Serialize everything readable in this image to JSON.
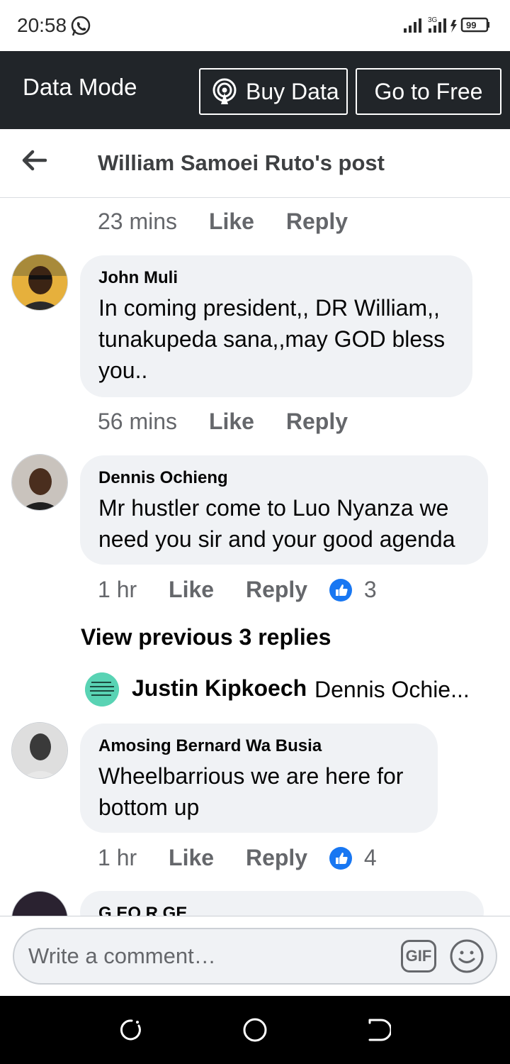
{
  "status_bar": {
    "time": "20:58",
    "network": "3G",
    "battery": "99"
  },
  "data_mode": {
    "title": "Data Mode",
    "buy_label": "Buy Data",
    "free_label": "Go to Free"
  },
  "header": {
    "title": "William Samoei Ruto's post"
  },
  "top_meta": {
    "time": "23 mins",
    "like": "Like",
    "reply": "Reply"
  },
  "comments": [
    {
      "author": "John Muli",
      "lines": [
        "In coming president,, DR William,,",
        "tunakupeda sana,,may GOD bless",
        "you.."
      ],
      "time": "56 mins",
      "like": "Like",
      "reply": "Reply",
      "reactions": ""
    },
    {
      "author": "Dennis Ochieng",
      "lines": [
        "Mr hustler come to Luo Nyanza we",
        "need you sir and your good agenda"
      ],
      "time": "1 hr",
      "like": "Like",
      "reply": "Reply",
      "reactions": "3"
    },
    {
      "author": "Amosing Bernard Wa Busia",
      "lines": [
        "Wheelbarrious we are here for",
        "bottom up"
      ],
      "time": "1 hr",
      "like": "Like",
      "reply": "Reply",
      "reactions": "4"
    },
    {
      "author": "G EO R GE"
    }
  ],
  "view_previous": "View previous 3 replies",
  "reply_preview": {
    "author": "Justin Kipkoech",
    "text": "Dennis Ochie..."
  },
  "composer": {
    "placeholder": "Write a comment…",
    "gif_label": "GIF"
  },
  "icons": {
    "like_color": "#1877f2",
    "header_bg": "#212529"
  }
}
